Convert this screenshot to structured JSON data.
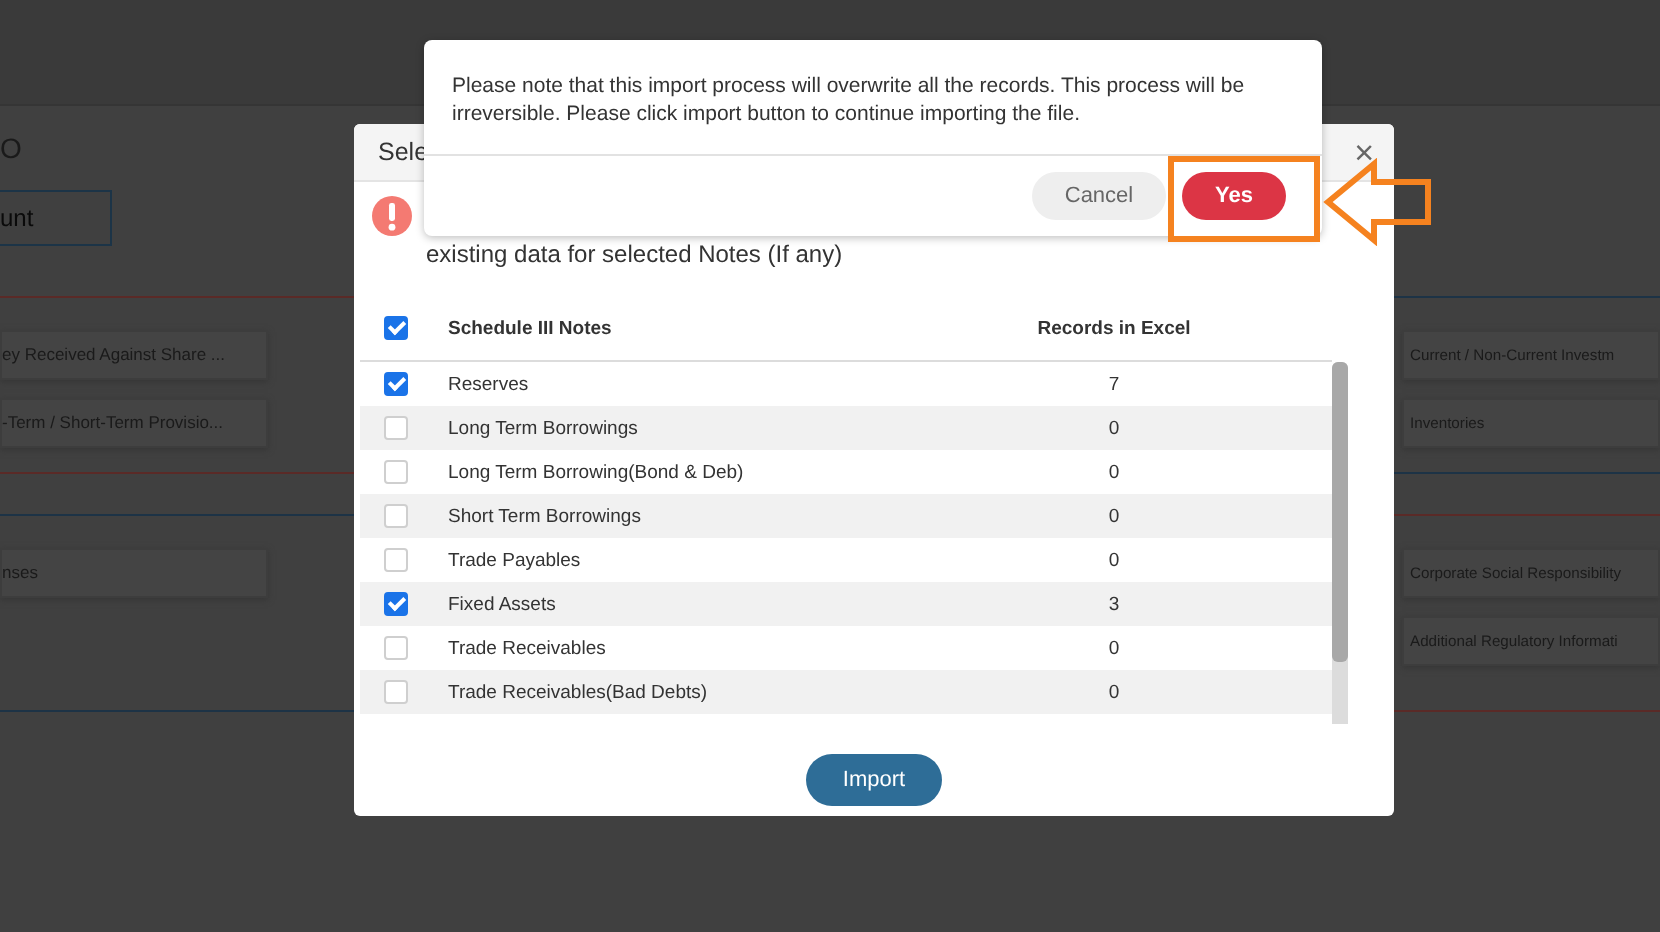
{
  "background_page": {
    "heading_fragment": "O",
    "button_fragment": "unt",
    "sections": [
      {
        "left_cards": [
          "ey Received Against Share ...",
          "-Term / Short-Term Provisio..."
        ],
        "right_cards": [
          "Current / Non-Current Investm",
          "Inventories"
        ]
      },
      {
        "left_cards": [
          "nses"
        ],
        "right_cards": [
          "Corporate Social Responsibility",
          "Additional Regulatory Informati"
        ]
      }
    ]
  },
  "import_dialog": {
    "title": "Sele",
    "close": "×",
    "notice": "existing data for selected Notes (If any)",
    "table": {
      "select_all_checked": true,
      "columns": [
        "Schedule III Notes",
        "Records in Excel"
      ],
      "rows": [
        {
          "note": "Reserves",
          "records": "7",
          "checked": true
        },
        {
          "note": "Long Term Borrowings",
          "records": "0",
          "checked": false
        },
        {
          "note": "Long Term Borrowing(Bond & Deb)",
          "records": "0",
          "checked": false
        },
        {
          "note": "Short Term Borrowings",
          "records": "0",
          "checked": false
        },
        {
          "note": "Trade Payables",
          "records": "0",
          "checked": false
        },
        {
          "note": "Fixed Assets",
          "records": "3",
          "checked": true
        },
        {
          "note": "Trade Receivables",
          "records": "0",
          "checked": false
        },
        {
          "note": "Trade Receivables(Bad Debts)",
          "records": "0",
          "checked": false
        }
      ]
    },
    "import_button": "Import"
  },
  "confirm_dialog": {
    "message": "Please note that this import process will overwrite all the records. This process will be irreversible. Please click import button to continue importing the file.",
    "buttons": [
      {
        "label": "Cancel",
        "kind": "secondary"
      },
      {
        "label": "Yes",
        "kind": "primary"
      }
    ]
  }
}
